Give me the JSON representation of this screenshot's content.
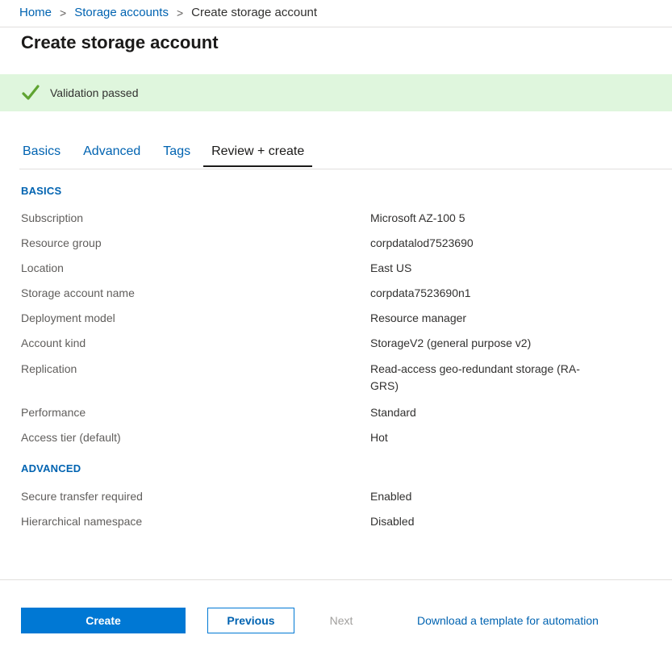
{
  "breadcrumb": {
    "home": "Home",
    "storage_accounts": "Storage accounts",
    "current": "Create storage account",
    "separator": ">"
  },
  "page": {
    "title": "Create storage account"
  },
  "validation": {
    "message": "Validation passed",
    "icon": "checkmark-icon",
    "color": "#5fa431",
    "background": "#dff6dd"
  },
  "tabs": [
    {
      "label": "Basics",
      "active": false
    },
    {
      "label": "Advanced",
      "active": false
    },
    {
      "label": "Tags",
      "active": false
    },
    {
      "label": "Review + create",
      "active": true
    }
  ],
  "review": {
    "basics": {
      "heading": "BASICS",
      "rows": [
        {
          "label": "Subscription",
          "value": "Microsoft AZ-100 5"
        },
        {
          "label": "Resource group",
          "value": "corpdatalod7523690"
        },
        {
          "label": "Location",
          "value": "East US"
        },
        {
          "label": "Storage account name",
          "value": "corpdata7523690n1"
        },
        {
          "label": "Deployment model",
          "value": "Resource manager"
        },
        {
          "label": "Account kind",
          "value": "StorageV2 (general purpose v2)"
        },
        {
          "label": "Replication",
          "value": "Read-access geo-redundant storage (RA-GRS)"
        },
        {
          "label": "Performance",
          "value": "Standard"
        },
        {
          "label": "Access tier (default)",
          "value": "Hot"
        }
      ]
    },
    "advanced": {
      "heading": "ADVANCED",
      "rows": [
        {
          "label": "Secure transfer required",
          "value": "Enabled"
        },
        {
          "label": "Hierarchical namespace",
          "value": "Disabled"
        }
      ]
    }
  },
  "footer": {
    "create_label": "Create",
    "previous_label": "Previous",
    "next_label": "Next",
    "template_link": "Download a template for automation"
  },
  "colors": {
    "accent": "#0078d4",
    "link": "#0063b1"
  }
}
